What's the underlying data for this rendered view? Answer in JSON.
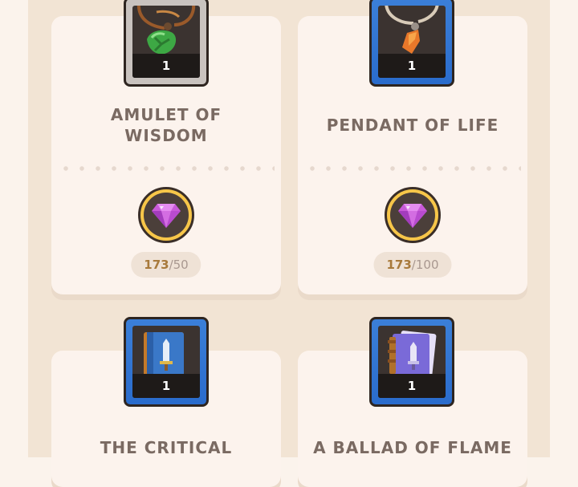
{
  "cards": [
    {
      "title_lines": [
        "AMULET OF",
        "WISDOM"
      ],
      "rarity": "gray",
      "count": "1",
      "icon": "green-amulet-icon",
      "currency_icon": "purple-gem-icon",
      "have": "173",
      "separator": "/",
      "need": "50"
    },
    {
      "title_lines": [
        "PENDANT OF LIFE"
      ],
      "rarity": "blue",
      "count": "1",
      "icon": "orange-pendant-icon",
      "currency_icon": "purple-gem-icon",
      "have": "173",
      "separator": "/",
      "need": "100"
    },
    {
      "title_lines": [
        "THE CRITICAL"
      ],
      "rarity": "blue",
      "count": "1",
      "icon": "blue-sword-book-icon"
    },
    {
      "title_lines": [
        "A BALLAD OF FLAME"
      ],
      "rarity": "blue",
      "count": "1",
      "icon": "purple-sword-book-icon"
    }
  ],
  "colors": {
    "rarity_gray": "#c9c3bf",
    "rarity_blue": "#2f74d0",
    "gem": "#c85ad8",
    "ring": "#f7c649",
    "have_text": "#a87a3c"
  }
}
